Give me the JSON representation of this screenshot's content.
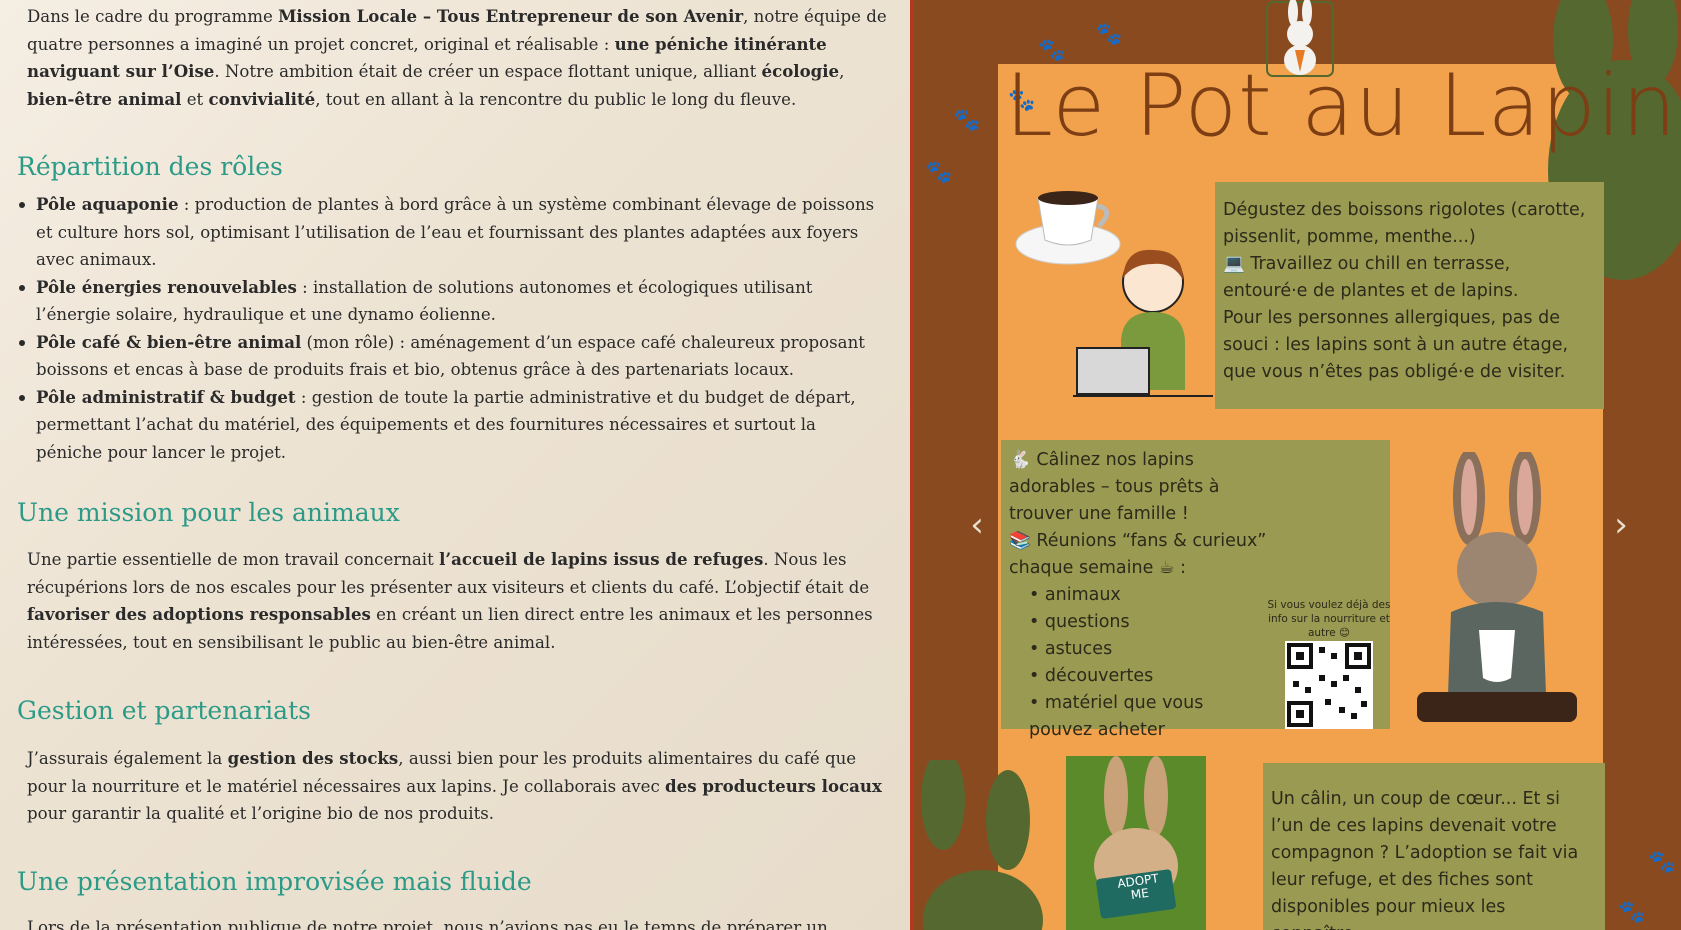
{
  "article": {
    "intro": {
      "t1": "Dans le cadre du programme ",
      "b1": "Mission Locale – Tous Entrepreneur de son Avenir",
      "t2": ", notre équipe de quatre personnes a imaginé un projet concret, original et réalisable : ",
      "b2": "une péniche itinérante naviguant sur l’Oise",
      "t3": ". Notre ambition était de créer un espace flottant unique, alliant ",
      "b3": "écologie",
      "t4": ", ",
      "b4": "bien-être animal",
      "t5": " et ",
      "b5": "convivialité",
      "t6": ", tout en allant à la rencontre du public le long du fleuve."
    },
    "h_roles": "Répartition des rôles",
    "roles": [
      {
        "b": "Pôle aquaponie",
        "t": " : production de plantes à bord grâce à un système combinant élevage de poissons et culture hors sol, optimisant l’utilisation de l’eau et fournissant des plantes adaptées aux foyers avec animaux."
      },
      {
        "b": "Pôle énergies renouvelables",
        "t": " : installation de solutions autonomes et écologiques utilisant l’énergie solaire, hydraulique et une dynamo éolienne."
      },
      {
        "b": "Pôle café & bien-être animal",
        "t": " (mon rôle) : aménagement d’un espace café chaleureux proposant boissons et encas à base de produits frais et bio, obtenus grâce à des partenariats locaux."
      },
      {
        "b": "Pôle administratif & budget",
        "t": " : gestion de toute la partie administrative et du budget de départ, permettant l’achat du matériel, des équipements et des fournitures nécessaires et surtout la péniche pour lancer le projet."
      }
    ],
    "h_mission": "Une mission pour les animaux",
    "mission": {
      "t1": "Une partie essentielle de mon travail concernait ",
      "b1": "l’accueil de lapins issus de refuges",
      "t2": ". Nous les récupérions lors de nos escales pour les présenter aux visiteurs et clients du café. L’objectif était de ",
      "b2": "favoriser des adoptions responsables",
      "t3": " en créant un lien direct entre les animaux et les personnes intéressées, tout en sensibilisant le public au bien-être animal."
    },
    "h_gestion": "Gestion et partenariats",
    "gestion": {
      "t1": "J’assurais également la ",
      "b1": "gestion des stocks",
      "t2": ", aussi bien pour les produits alimentaires du café que pour la nourriture et le matériel nécessaires aux lapins. Je collaborais avec ",
      "b2": "des producteurs locaux",
      "t3": " pour garantir la qualité et l’origine bio de nos produits."
    },
    "h_presentation": "Une présentation improvisée mais fluide",
    "presentation_start": "Lors de la présentation publique de notre projet, nous n’avions pas eu le temps de préparer un discours"
  },
  "poster": {
    "title": "Le Pot au Lapin",
    "panel1": "Dégustez des boissons rigolotes (carotte, pissenlit, pomme, menthe...)\n💻 Travaillez ou chill en terrasse, entouré·e de plantes et de lapins.\n Pour les personnes allergiques, pas de souci : les lapins sont à un autre étage, que vous n’êtes pas obligé·e de visiter.",
    "panel2_intro": "🐇 Câlinez nos lapins adorables – tous prêts à trouver une famille !\n📚 Réunions “fans & curieux” chaque semaine ☕ :",
    "panel2_items": [
      "animaux",
      "questions",
      "astuces",
      "découvertes",
      "matériel que vous pouvez acheter"
    ],
    "qr_label": "Si vous voulez déjà des info sur la nourriture et autre 😊",
    "panel3": "Un câlin, un coup de cœur... Et si l’un de ces lapins devenait votre compagnon ? L’adoption se fait via leur refuge, et des fiches sont disponibles pour mieux les connaître.",
    "adopt_sign": "ADOPT ME",
    "prev_arrow": "‹",
    "next_arrow": "›"
  },
  "colors": {
    "heading": "#2b9a87",
    "poster_brown": "#8a4a1f",
    "poster_orange": "#f2a24c",
    "panel_olive": "#9a9a52",
    "bunny_green": "#55682f"
  }
}
